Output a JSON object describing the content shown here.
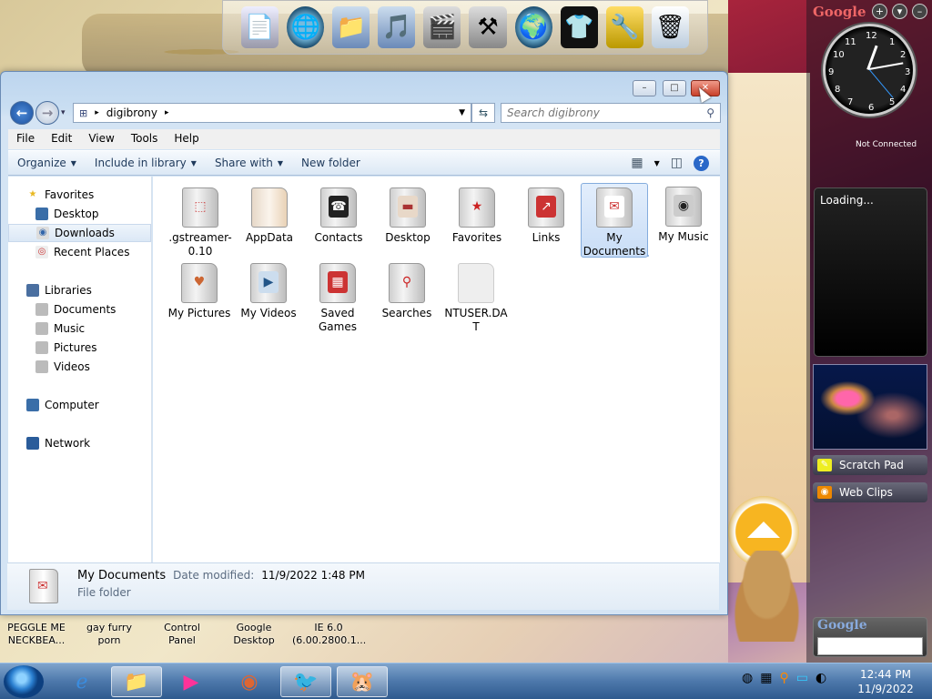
{
  "window": {
    "address_crumb": "digibrony",
    "search_placeholder": "Search digibrony",
    "minimize": "–",
    "maximize": "□",
    "close": "✕",
    "back": "←",
    "forward": "→"
  },
  "menubar": [
    "File",
    "Edit",
    "View",
    "Tools",
    "Help"
  ],
  "commandbar": {
    "organize": "Organize",
    "include_in_library": "Include in library",
    "share_with": "Share with",
    "new_folder": "New folder",
    "help": "?"
  },
  "navpane": {
    "favorites": "Favorites",
    "desktop": "Desktop",
    "downloads": "Downloads",
    "recent_places": "Recent Places",
    "libraries": "Libraries",
    "documents": "Documents",
    "music": "Music",
    "pictures": "Pictures",
    "videos": "Videos",
    "computer": "Computer",
    "network": "Network"
  },
  "files": [
    {
      "name": ".gstreamer-0.10",
      "line1": ".gstreamer-",
      "line2": "0.10"
    },
    {
      "name": "AppData",
      "line1": "AppData",
      "line2": ""
    },
    {
      "name": "Contacts",
      "line1": "Contacts",
      "line2": ""
    },
    {
      "name": "Desktop",
      "line1": "Desktop",
      "line2": ""
    },
    {
      "name": "Favorites",
      "line1": "Favorites",
      "line2": ""
    },
    {
      "name": "Links",
      "line1": "Links",
      "line2": ""
    },
    {
      "name": "My Documents",
      "line1": "My",
      "line2": "Documents"
    },
    {
      "name": "My Music",
      "line1": "My Music",
      "line2": ""
    },
    {
      "name": "My Pictures",
      "line1": "My Pictures",
      "line2": ""
    },
    {
      "name": "My Videos",
      "line1": "My Videos",
      "line2": ""
    },
    {
      "name": "Saved Games",
      "line1": "Saved",
      "line2": "Games"
    },
    {
      "name": "Searches",
      "line1": "Searches",
      "line2": ""
    },
    {
      "name": "NTUSER.DAT",
      "line1": "NTUSER.DA",
      "line2": "T"
    }
  ],
  "details": {
    "name": "My Documents",
    "date_label": "Date modified:",
    "date_value": "11/9/2022 1:48 PM",
    "type": "File folder"
  },
  "desktop_icons": [
    {
      "line1": "PEGGLE ME",
      "line2": "NECKBEA..."
    },
    {
      "line1": "gay furry",
      "line2": "porn"
    },
    {
      "line1": "Control Panel",
      "line2": ""
    },
    {
      "line1": "Google",
      "line2": "Desktop"
    },
    {
      "line1": "IE 6.0",
      "line2": "(6.00.2800.1..."
    }
  ],
  "gadgets": {
    "google_logo": "Google",
    "not_connected": "Not Connected",
    "loading": "Loading...",
    "scratch_pad": "Scratch Pad",
    "web_clips": "Web Clips",
    "search_logo": "Google"
  },
  "clock_numbers": [
    "12",
    "1",
    "2",
    "3",
    "4",
    "5",
    "6",
    "7",
    "8",
    "9",
    "10",
    "11"
  ],
  "taskbar": {
    "time": "12:44 PM",
    "date": "11/9/2022"
  }
}
